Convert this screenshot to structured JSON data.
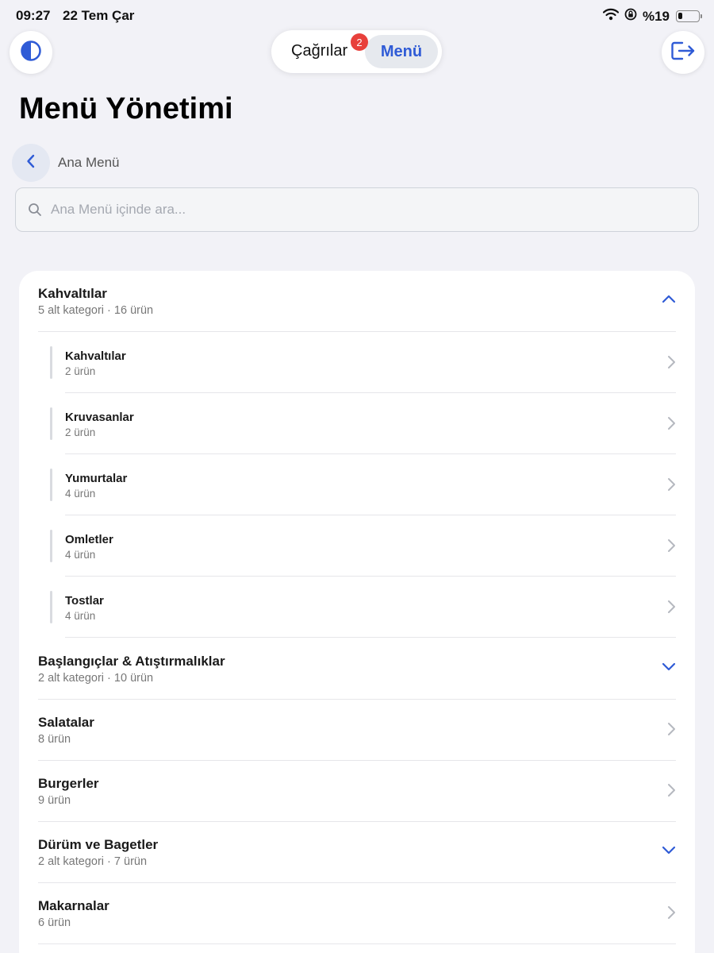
{
  "status_bar": {
    "time": "09:27",
    "date": "22 Tem Çar",
    "battery": "%19",
    "battery_level": 0.19
  },
  "top_bar": {
    "tab_calls": "Çağrılar",
    "tab_calls_badge": "2",
    "tab_menu": "Menü",
    "active_tab": "Menü",
    "accent_color": "#2f5bd6",
    "badge_color": "#e8403b",
    "theme_icon": "contrast-icon",
    "logout_icon": "logout-icon"
  },
  "page": {
    "title": "Menü Yönetimi",
    "breadcrumb": "Ana Menü"
  },
  "search": {
    "placeholder": "Ana Menü içinde ara...",
    "value": ""
  },
  "categories": [
    {
      "name": "Kahvaltılar",
      "meta": "5 alt kategori · 16 ürün",
      "state": "expanded",
      "subcategories": [
        {
          "name": "Kahvaltılar",
          "meta": "2 ürün"
        },
        {
          "name": "Kruvasanlar",
          "meta": "2 ürün"
        },
        {
          "name": "Yumurtalar",
          "meta": "4 ürün"
        },
        {
          "name": "Omletler",
          "meta": "4 ürün"
        },
        {
          "name": "Tostlar",
          "meta": "4 ürün"
        }
      ]
    },
    {
      "name": "Başlangıçlar & Atıştırmalıklar",
      "meta": "2 alt kategori · 10 ürün",
      "state": "collapsed"
    },
    {
      "name": "Salatalar",
      "meta": "8 ürün",
      "state": "link"
    },
    {
      "name": "Burgerler",
      "meta": "9 ürün",
      "state": "link"
    },
    {
      "name": "Dürüm ve Bagetler",
      "meta": "2 alt kategori · 7 ürün",
      "state": "collapsed"
    },
    {
      "name": "Makarnalar",
      "meta": "6 ürün",
      "state": "link"
    }
  ]
}
